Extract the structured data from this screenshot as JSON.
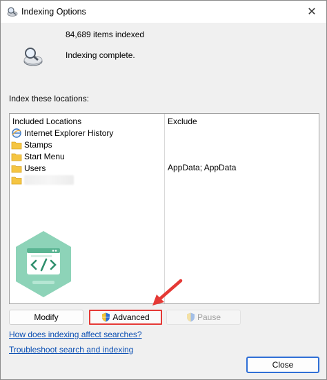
{
  "window": {
    "title": "Indexing Options",
    "close_glyph": "✕"
  },
  "summary": {
    "items_indexed": "84,689 items indexed",
    "status": "Indexing complete."
  },
  "locations": {
    "label": "Index these locations:",
    "headers": {
      "included": "Included Locations",
      "exclude": "Exclude"
    },
    "rows": [
      {
        "name": "Internet Explorer History",
        "icon": "ie-history-icon",
        "exclude": ""
      },
      {
        "name": "Stamps",
        "icon": "folder-icon",
        "exclude": ""
      },
      {
        "name": "Start Menu",
        "icon": "folder-icon",
        "exclude": ""
      },
      {
        "name": "Users",
        "icon": "folder-icon",
        "exclude": "AppData; AppData"
      },
      {
        "name": "",
        "icon": "folder-icon",
        "exclude": ""
      }
    ]
  },
  "buttons": {
    "modify": "Modify",
    "advanced": "Advanced",
    "pause": "Pause",
    "close": "Close"
  },
  "links": {
    "affect": "How does indexing affect searches?",
    "troubleshoot": "Troubleshoot search and indexing"
  },
  "colors": {
    "accent": "#2f6fd6",
    "highlight": "#e53935",
    "link": "#0b4fb3",
    "folder": "#f5c542"
  },
  "icons": {
    "title": "indexing-options-icon",
    "status": "magnifier-drive-icon",
    "shield": "uac-shield-icon",
    "watermark": "code-badge-watermark"
  }
}
